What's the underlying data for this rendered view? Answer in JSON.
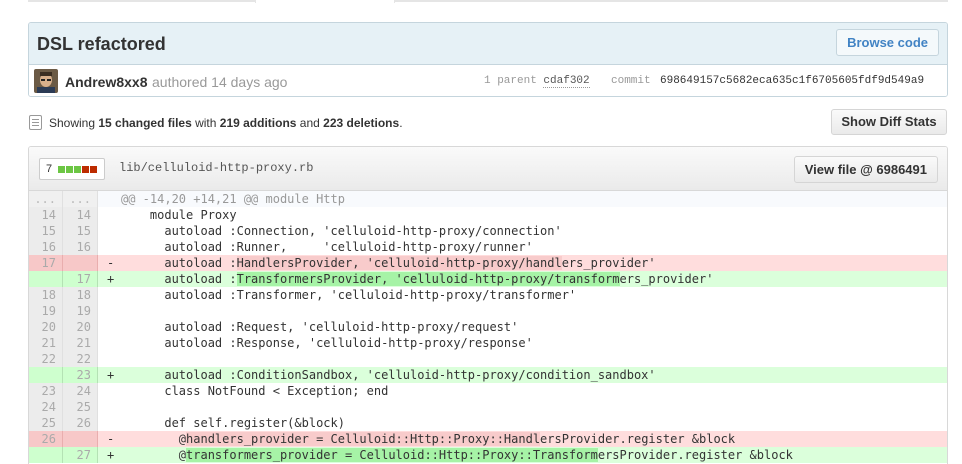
{
  "commit": {
    "title": "DSL refactored",
    "browse_label": "Browse code",
    "author": "Andrew8xx8",
    "authored": "authored 14 days ago",
    "parent_label": "1 parent",
    "parent_sha": "cdaf302",
    "commit_label": "commit",
    "commit_sha": "698649157c5682eca635c1f6705605fdf9d549a9"
  },
  "summary": {
    "prefix": "Showing ",
    "files": "15 changed files",
    "with": " with ",
    "additions": "219 additions",
    "and": " and ",
    "deletions": "223 deletions",
    "period": ".",
    "diffstats_label": "Show Diff Stats"
  },
  "file": {
    "change_count": "7",
    "path": "lib/celluloid-http-proxy.rb",
    "view_label": "View file @ 6986491",
    "blocks": [
      "add",
      "add",
      "add",
      "del",
      "del"
    ],
    "colors": {
      "add": "#6cc644",
      "del": "#bd2c00"
    }
  },
  "diff_lines": [
    {
      "type": "hunk",
      "old": "...",
      "new": "...",
      "marker": "",
      "segments": [
        {
          "t": "@@ -14,20 +14,21 @@ module Http",
          "h": false
        }
      ]
    },
    {
      "type": "ctx",
      "old": "14",
      "new": "14",
      "marker": "",
      "segments": [
        {
          "t": "    module Proxy",
          "h": false
        }
      ]
    },
    {
      "type": "ctx",
      "old": "15",
      "new": "15",
      "marker": "",
      "segments": [
        {
          "t": "      autoload :Connection, 'celluloid-http-proxy/connection'",
          "h": false
        }
      ]
    },
    {
      "type": "ctx",
      "old": "16",
      "new": "16",
      "marker": "",
      "segments": [
        {
          "t": "      autoload :Runner,     'celluloid-http-proxy/runner'",
          "h": false
        }
      ]
    },
    {
      "type": "del",
      "old": "17",
      "new": "",
      "marker": "-",
      "segments": [
        {
          "t": "      autoload :",
          "h": false
        },
        {
          "t": "HandlersProvider, 'celluloid-http-proxy/handl",
          "h": true
        },
        {
          "t": "ers_provider'",
          "h": false
        }
      ]
    },
    {
      "type": "add",
      "old": "",
      "new": "17",
      "marker": "+",
      "segments": [
        {
          "t": "      autoload :",
          "h": false
        },
        {
          "t": "TransformersProvider, 'celluloid-http-proxy/transform",
          "h": true
        },
        {
          "t": "ers_provider'",
          "h": false
        }
      ]
    },
    {
      "type": "ctx",
      "old": "18",
      "new": "18",
      "marker": "",
      "segments": [
        {
          "t": "      autoload :Transformer, 'celluloid-http-proxy/transformer'",
          "h": false
        }
      ]
    },
    {
      "type": "ctx",
      "old": "19",
      "new": "19",
      "marker": "",
      "segments": [
        {
          "t": "",
          "h": false
        }
      ]
    },
    {
      "type": "ctx",
      "old": "20",
      "new": "20",
      "marker": "",
      "segments": [
        {
          "t": "      autoload :Request, 'celluloid-http-proxy/request'",
          "h": false
        }
      ]
    },
    {
      "type": "ctx",
      "old": "21",
      "new": "21",
      "marker": "",
      "segments": [
        {
          "t": "      autoload :Response, 'celluloid-http-proxy/response'",
          "h": false
        }
      ]
    },
    {
      "type": "ctx",
      "old": "22",
      "new": "22",
      "marker": "",
      "segments": [
        {
          "t": "",
          "h": false
        }
      ]
    },
    {
      "type": "add",
      "old": "",
      "new": "23",
      "marker": "+",
      "segments": [
        {
          "t": "      autoload :ConditionSandbox, 'celluloid-http-proxy/condition_sandbox'",
          "h": false
        }
      ]
    },
    {
      "type": "ctx",
      "old": "23",
      "new": "24",
      "marker": "",
      "segments": [
        {
          "t": "      class NotFound < Exception; end",
          "h": false
        }
      ]
    },
    {
      "type": "ctx",
      "old": "24",
      "new": "25",
      "marker": "",
      "segments": [
        {
          "t": "",
          "h": false
        }
      ]
    },
    {
      "type": "ctx",
      "old": "25",
      "new": "26",
      "marker": "",
      "segments": [
        {
          "t": "      def self.register(&block)",
          "h": false
        }
      ]
    },
    {
      "type": "del",
      "old": "26",
      "new": "",
      "marker": "-",
      "segments": [
        {
          "t": "        @",
          "h": false
        },
        {
          "t": "handlers_provider = Celluloid::Http::Proxy::Handl",
          "h": true
        },
        {
          "t": "ersProvider.register &block",
          "h": false
        }
      ]
    },
    {
      "type": "add",
      "old": "",
      "new": "27",
      "marker": "+",
      "segments": [
        {
          "t": "        @",
          "h": false
        },
        {
          "t": "transformers_provider = Celluloid::Http::Proxy::Transform",
          "h": true
        },
        {
          "t": "ersProvider.register &block",
          "h": false
        }
      ]
    }
  ]
}
